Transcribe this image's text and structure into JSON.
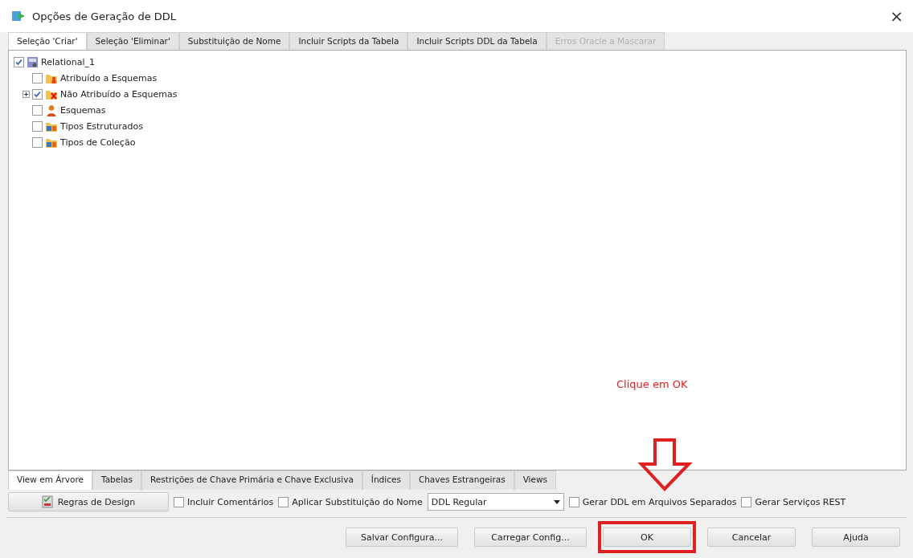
{
  "window": {
    "title": "Opções de Geração de DDL",
    "close": "×"
  },
  "tabs": [
    {
      "label": "Seleção 'Criar'",
      "selected": true,
      "disabled": false
    },
    {
      "label": "Seleção 'Eliminar'",
      "selected": false,
      "disabled": false
    },
    {
      "label": "Substituição de Nome",
      "selected": false,
      "disabled": false
    },
    {
      "label": "Incluir Scripts da Tabela",
      "selected": false,
      "disabled": false
    },
    {
      "label": "Incluir Scripts DDL da Tabela",
      "selected": false,
      "disabled": false
    },
    {
      "label": "Erros Oracle a Mascarar",
      "selected": false,
      "disabled": true
    }
  ],
  "tree": {
    "label": "Relational_1",
    "checked": true,
    "kind": "model",
    "children": [
      {
        "label": "Atribuído a Esquemas",
        "checked": false,
        "kind": "folder-user",
        "expandable": false
      },
      {
        "label": "Não Atribuído a Esquemas",
        "checked": true,
        "kind": "folder-x",
        "expandable": true
      },
      {
        "label": "Esquemas",
        "checked": false,
        "kind": "user",
        "expandable": false
      },
      {
        "label": "Tipos Estruturados",
        "checked": false,
        "kind": "types",
        "expandable": false
      },
      {
        "label": "Tipos de Coleção",
        "checked": false,
        "kind": "types",
        "expandable": false
      }
    ]
  },
  "annotation": {
    "text": "Clique em OK"
  },
  "view_tabs": [
    {
      "label": "View em Árvore",
      "selected": true
    },
    {
      "label": "Tabelas",
      "selected": false
    },
    {
      "label": "Restrições de Chave Primária e Chave Exclusiva",
      "selected": false
    },
    {
      "label": "Índices",
      "selected": false
    },
    {
      "label": "Chaves Estrangeiras",
      "selected": false
    },
    {
      "label": "Views",
      "selected": false
    }
  ],
  "options": {
    "design_rules_button": "Regras de Design",
    "checks": [
      {
        "label": "Incluir Comentários",
        "checked": false
      },
      {
        "label": "Aplicar Substituição do Nome",
        "checked": false
      }
    ],
    "ddl_select": "DDL Regular",
    "checks_after": [
      {
        "label": "Gerar DDL em Arquivos Separados",
        "checked": false
      },
      {
        "label": "Gerar Serviços REST",
        "checked": false
      }
    ]
  },
  "buttons": [
    {
      "label": "Salvar Configura...",
      "highlighted": false
    },
    {
      "label": "Carregar Config...",
      "highlighted": false
    },
    {
      "label": "OK",
      "highlighted": true
    },
    {
      "label": "Cancelar",
      "highlighted": false
    },
    {
      "label": "Ajuda",
      "highlighted": false
    }
  ]
}
